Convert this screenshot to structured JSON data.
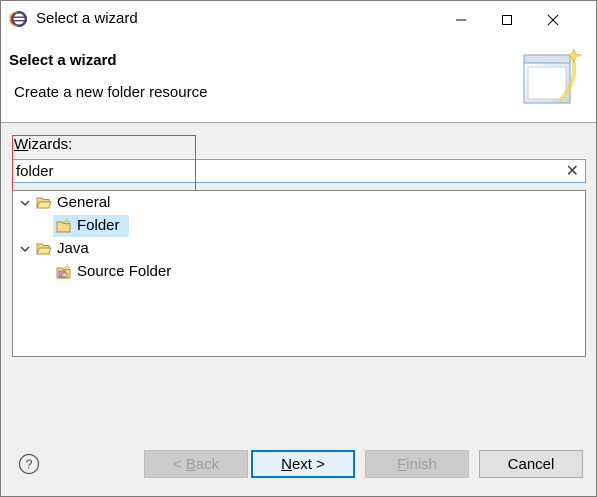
{
  "window": {
    "title": "Select a wizard",
    "controls": {
      "minimize": "—",
      "maximize": "☐",
      "close": "✕"
    }
  },
  "banner": {
    "title": "Select a wizard",
    "description": "Create a new folder resource",
    "graphic_icon": "wizard-banner-icon"
  },
  "wizards": {
    "label_mnemonic": "W",
    "label_rest": "izards:",
    "filter_value": "folder",
    "clear_icon": "✕"
  },
  "tree": {
    "items": [
      {
        "label": "General",
        "type": "category",
        "expanded": true,
        "icon": "open-folder-icon"
      },
      {
        "label": "Folder",
        "type": "wizard",
        "selected": true,
        "icon": "new-folder-icon"
      },
      {
        "label": "Java",
        "type": "category",
        "expanded": true,
        "icon": "open-folder-icon"
      },
      {
        "label": "Source Folder",
        "type": "wizard",
        "selected": false,
        "icon": "source-folder-icon"
      }
    ]
  },
  "buttons": {
    "help": "?",
    "back_mnemonic": "B",
    "back_pre": "< ",
    "back_rest": "ack",
    "next_mnemonic": "N",
    "next_rest": "ext >",
    "finish_mnemonic": "F",
    "finish_rest": "inish",
    "cancel": "Cancel"
  },
  "colors": {
    "selection": "#cce8ff",
    "default_button_border": "#0078d7",
    "highlight_box": "#e04040"
  }
}
